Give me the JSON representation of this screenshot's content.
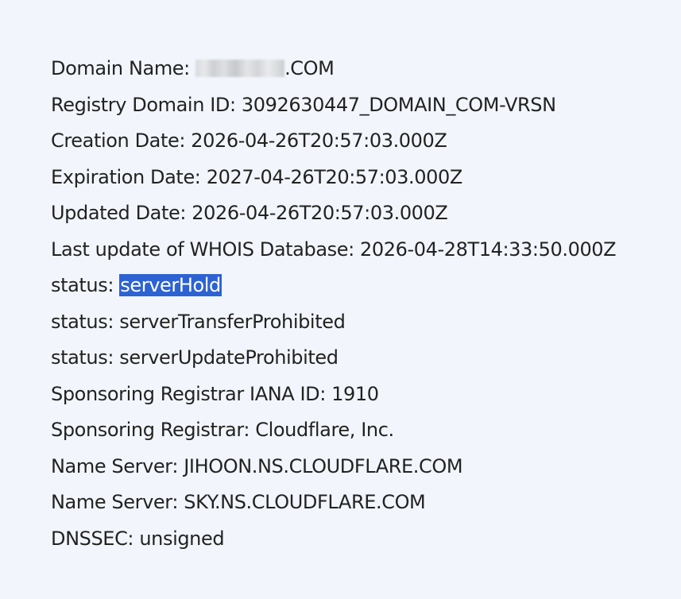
{
  "whois": {
    "domain_label": "Domain Name: ",
    "domain_suffix": ".COM",
    "lines": [
      "Registry Domain ID: 3092630447_DOMAIN_COM-VRSN",
      "Creation Date: 2026-04-26T20:57:03.000Z",
      "Expiration Date: 2027-04-26T20:57:03.000Z",
      "Updated Date: 2026-04-26T20:57:03.000Z",
      "Last update of WHOIS Database: 2026-04-28T14:33:50.000Z"
    ],
    "status_label": "status: ",
    "status_selected": "serverHold",
    "lines_after": [
      "status: serverTransferProhibited",
      "status: serverUpdateProhibited",
      "Sponsoring Registrar IANA ID: 1910",
      "Sponsoring Registrar: Cloudflare, Inc.",
      "Name Server: JIHOON.NS.CLOUDFLARE.COM",
      "Name Server: SKY.NS.CLOUDFLARE.COM",
      "DNSSEC: unsigned"
    ]
  }
}
